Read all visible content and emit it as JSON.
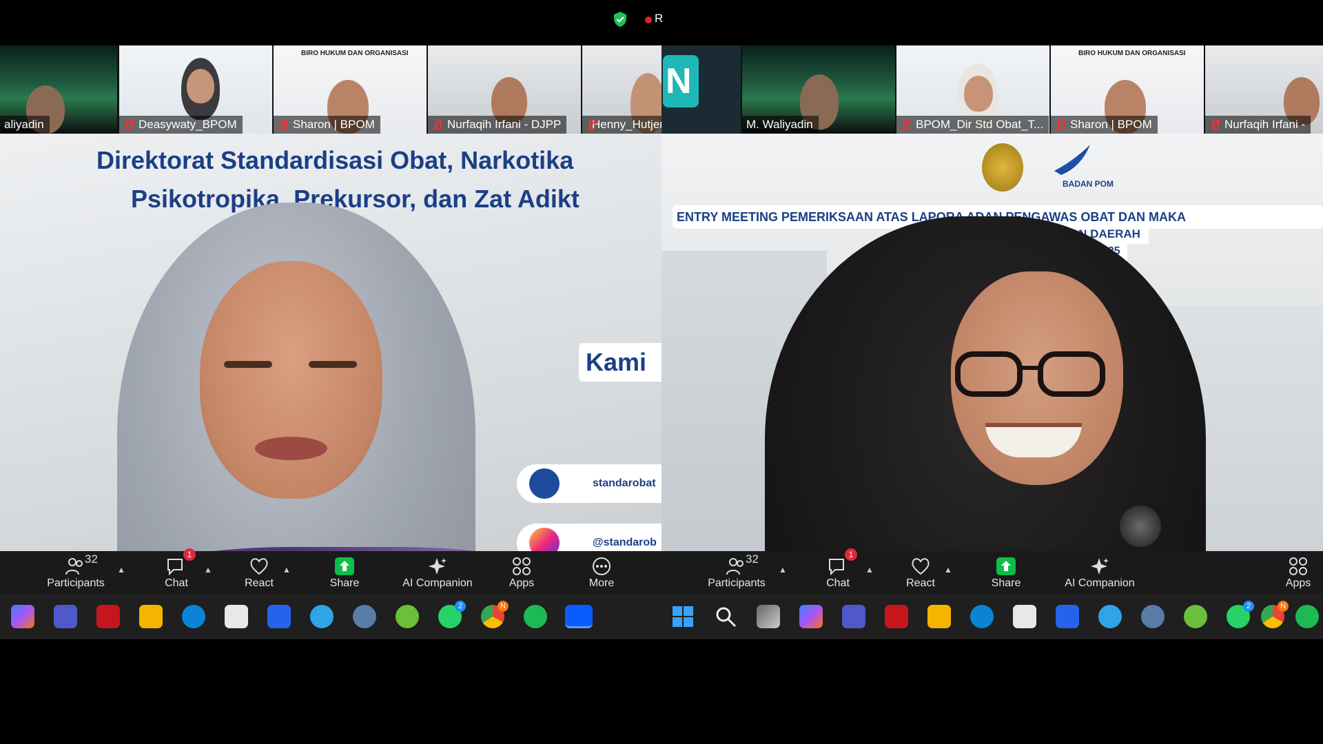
{
  "top": {
    "rec_label": "R"
  },
  "left": {
    "thumbnails": [
      {
        "name": "aliyadin",
        "style": "aurora"
      },
      {
        "name": "Deasywaty_BPOM",
        "style": "slide1",
        "muted": true
      },
      {
        "name": "Sharon | BPOM",
        "style": "slide2",
        "muted": true,
        "slide_text": "BIRO HUKUM DAN ORGANISASI"
      },
      {
        "name": "Nurfaqih Irfani - DJPP",
        "style": "wall",
        "muted": true
      },
      {
        "name": "Henny_Hutjen PP",
        "style": "wall",
        "muted": true
      }
    ],
    "slide": {
      "title1": "Direktorat Standardisasi Obat, Narkotika",
      "title2": "Psikotropika, Prekursor, dan Zat Adikt",
      "kami": "Kami",
      "web": "standarobat",
      "ig": "@standarob",
      "other": "standarob"
    }
  },
  "right": {
    "thumbnails": [
      {
        "name": "",
        "style": "teal",
        "tile": "N"
      },
      {
        "name": "M. Waliyadin",
        "style": "aurora"
      },
      {
        "name": "BPOM_Dir Std Obat_T...",
        "style": "slide1",
        "muted": true
      },
      {
        "name": "Sharon | BPOM",
        "style": "slide2",
        "muted": true,
        "slide_text": "BIRO HUKUM DAN ORGANISASI"
      },
      {
        "name": "Nurfaqih Irfani -",
        "style": "wall",
        "muted": true
      }
    ],
    "slide": {
      "banner": "ENTRY MEETING PEMERIKSAAN ATAS LAPORA            ADAN PENGAWAS OBAT DAN MAKA",
      "line2": "DI P                                 DAN DAERAH",
      "year": "2025",
      "logo_text": "BADAN POM"
    }
  },
  "toolbar": {
    "participants_label": "Participants",
    "participants_count": "32",
    "chat_label": "Chat",
    "chat_badge": "1",
    "react_label": "React",
    "share_label": "Share",
    "ai_label": "AI Companion",
    "apps_label": "Apps",
    "more_label": "More"
  },
  "taskbar_badges": {
    "whatsapp": "2",
    "chrome": "N"
  },
  "colors": {
    "share_green": "#0bbf4a",
    "badge_red": "#e0293b",
    "brand_blue": "#1b3f86"
  }
}
